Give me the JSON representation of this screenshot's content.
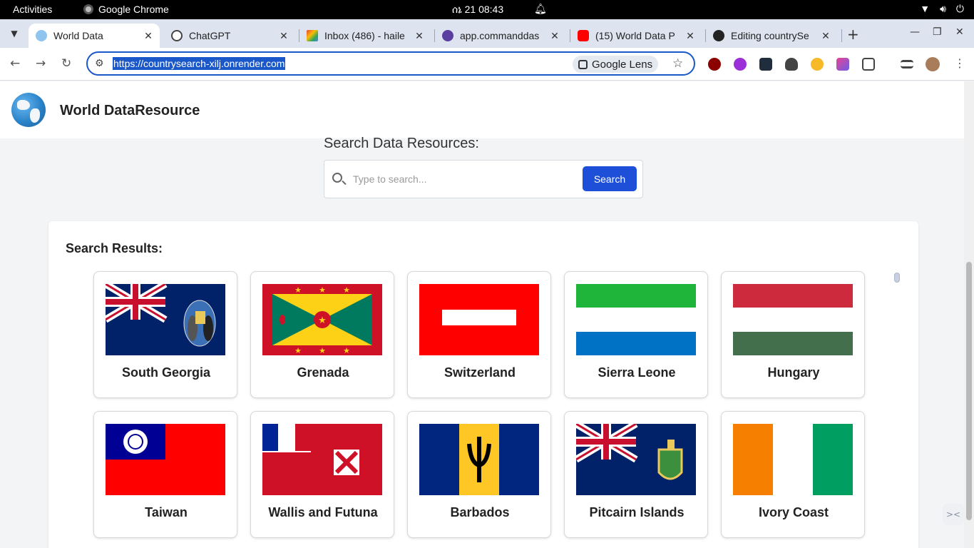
{
  "system_bar": {
    "activities": "Activities",
    "app_name": "Google Chrome",
    "clock": "ሰኔ 21  08:43",
    "tray_icons": [
      "wifi-icon",
      "volume-icon",
      "power-icon"
    ]
  },
  "tabs": [
    {
      "title": "World Data",
      "favicon": "globe-icon",
      "active": true
    },
    {
      "title": "ChatGPT",
      "favicon": "openai-icon",
      "active": false
    },
    {
      "title": "Inbox (486) - haile",
      "favicon": "gmail-icon",
      "active": false
    },
    {
      "title": "app.commanddas",
      "favicon": "app-icon",
      "active": false
    },
    {
      "title": "(15) World Data P",
      "favicon": "youtube-icon",
      "active": false
    },
    {
      "title": "Editing countrySe",
      "favicon": "github-icon",
      "active": false
    }
  ],
  "toolbar": {
    "url": "https://countrysearch-xilj.onrender.com",
    "lens_label": "Google Lens"
  },
  "colors": {
    "accent": "#1d4fd8",
    "url_highlight": "#1a57c9",
    "page_bg": "#f3f4f6"
  },
  "site": {
    "title": "World DataResource"
  },
  "search": {
    "label": "Search Data Resources:",
    "placeholder": "Type to search...",
    "value": "",
    "button": "Search"
  },
  "results": {
    "title": "Search Results:",
    "countries": [
      {
        "name": "South Georgia",
        "flag": "south-georgia"
      },
      {
        "name": "Grenada",
        "flag": "grenada"
      },
      {
        "name": "Switzerland",
        "flag": "switzerland"
      },
      {
        "name": "Sierra Leone",
        "flag": "sierra-leone"
      },
      {
        "name": "Hungary",
        "flag": "hungary"
      },
      {
        "name": "Taiwan",
        "flag": "taiwan"
      },
      {
        "name": "Wallis and Futuna",
        "flag": "wallis-and-futuna"
      },
      {
        "name": "Barbados",
        "flag": "barbados"
      },
      {
        "name": "Pitcairn Islands",
        "flag": "pitcairn-islands"
      },
      {
        "name": "Ivory Coast",
        "flag": "ivory-coast"
      }
    ]
  }
}
